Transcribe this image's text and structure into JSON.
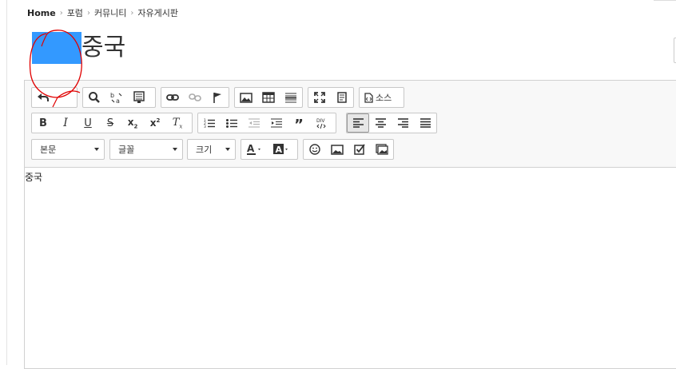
{
  "breadcrumb": {
    "home": "Home",
    "items": [
      "포럼",
      "커뮤니티",
      "자유게시판"
    ]
  },
  "title": "중국",
  "editor": {
    "dropdowns": {
      "paragraph": "본문",
      "font": "글꼴",
      "size": "크기"
    },
    "source_label": "소스",
    "content": "중국"
  },
  "colors": {
    "mask": "#3399ff",
    "annotation": "#e00000"
  }
}
